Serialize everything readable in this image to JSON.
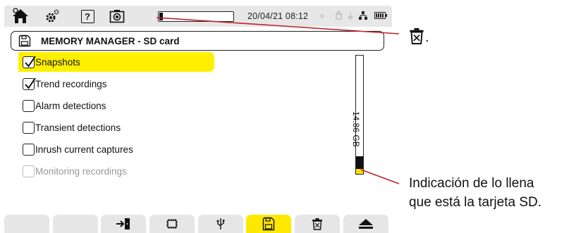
{
  "topbar": {
    "icons": [
      "home-icon",
      "settings-icon",
      "help-icon",
      "camera-icon"
    ],
    "help_label": "?",
    "progress_fraction": 0.05,
    "datetime": "20/04/21 08:12",
    "status_icons": [
      "sun-icon",
      "lock-icon",
      "usb-icon",
      "network-icon",
      "battery-icon"
    ]
  },
  "title": {
    "icon": "sd-card-icon",
    "text": "MEMORY MANAGER - SD card"
  },
  "items": [
    {
      "label": "Snapshots",
      "checked": true,
      "selected": true,
      "enabled": true
    },
    {
      "label": "Trend recordings",
      "checked": true,
      "selected": false,
      "enabled": true
    },
    {
      "label": "Alarm detections",
      "checked": false,
      "selected": false,
      "enabled": true
    },
    {
      "label": "Transient detections",
      "checked": false,
      "selected": false,
      "enabled": true
    },
    {
      "label": "Inrush current captures",
      "checked": false,
      "selected": false,
      "enabled": true
    },
    {
      "label": "Monitoring recordings",
      "checked": false,
      "selected": false,
      "enabled": false
    }
  ],
  "gauge": {
    "capacity_label": "14.86 GB",
    "fill_fraction": 0.15,
    "fill_color": "#ffe000"
  },
  "function_keys": [
    {
      "icon": "",
      "active": false
    },
    {
      "icon": "",
      "active": false
    },
    {
      "icon": "exit-icon",
      "active": false
    },
    {
      "icon": "chip-icon",
      "active": false
    },
    {
      "icon": "usb-icon",
      "active": false
    },
    {
      "icon": "sd-card-icon",
      "active": true
    },
    {
      "icon": "trash-icon",
      "active": false
    },
    {
      "icon": "eject-icon",
      "active": false
    }
  ],
  "annotations": {
    "trash_period": ".",
    "gauge_note_line1": "Indicación de lo llena",
    "gauge_note_line2": "que está la tarjeta SD."
  },
  "colors": {
    "selection": "#fff000",
    "active_key": "#ffe800",
    "callout": "#c0212b"
  }
}
